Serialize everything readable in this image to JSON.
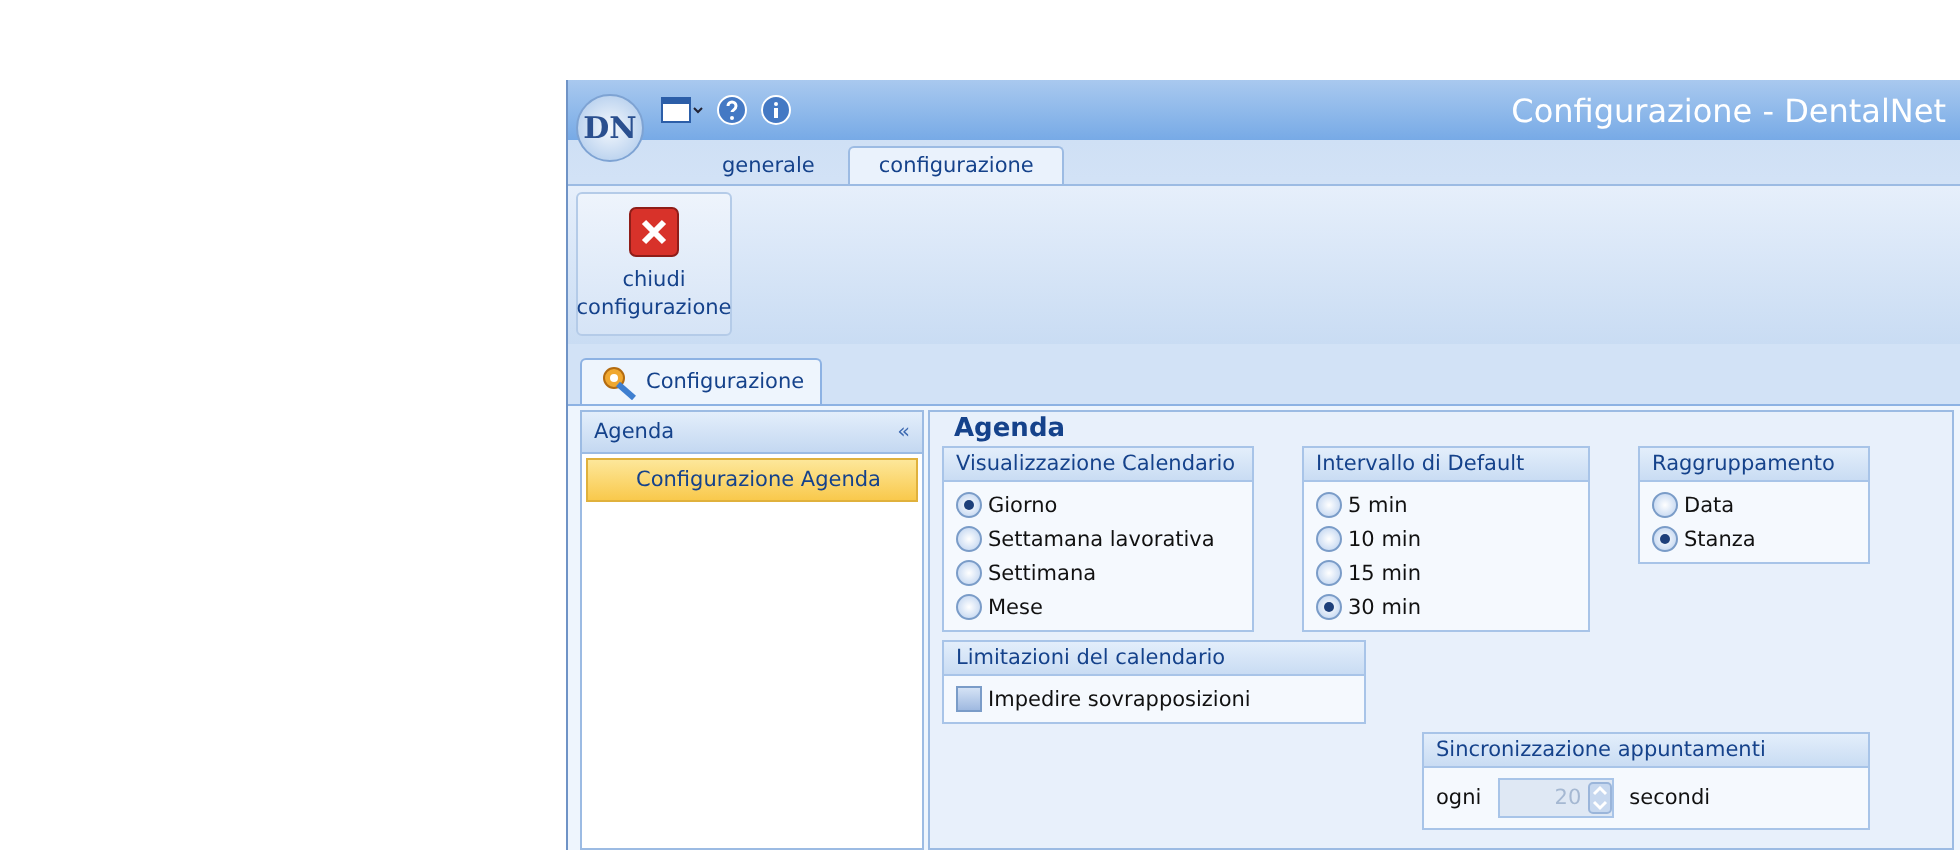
{
  "window": {
    "title": "Configurazione - DentalNet",
    "app_logo": "DN"
  },
  "ribbon_tabs": [
    {
      "label": "generale",
      "selected": false
    },
    {
      "label": "configurazione",
      "selected": true
    }
  ],
  "ribbon_buttons": [
    {
      "label": "chiudi configurazione"
    }
  ],
  "document_tabs": [
    {
      "label": "Configurazione",
      "selected": true
    }
  ],
  "sidebar": {
    "header": "Agenda",
    "collapse": "«",
    "items": [
      {
        "label": "Configurazione Agenda",
        "selected": true
      }
    ]
  },
  "content": {
    "title": "Agenda",
    "groups": [
      {
        "kind": "radio",
        "title": "Visualizzazione Calendario",
        "options": [
          {
            "label": "Giorno",
            "selected": true
          },
          {
            "label": "Settamana lavorativa",
            "selected": false
          },
          {
            "label": "Settimana",
            "selected": false
          },
          {
            "label": "Mese",
            "selected": false
          }
        ]
      },
      {
        "kind": "radio",
        "title": "Intervallo di Default",
        "options": [
          {
            "label": "5 min",
            "selected": false
          },
          {
            "label": "10 min",
            "selected": false
          },
          {
            "label": "15 min",
            "selected": false
          },
          {
            "label": "30 min",
            "selected": true
          }
        ]
      },
      {
        "kind": "radio",
        "title": "Raggruppamento",
        "options": [
          {
            "label": "Data",
            "selected": false
          },
          {
            "label": "Stanza",
            "selected": true
          }
        ]
      },
      {
        "kind": "checkbox",
        "title": "Limitazioni del calendario",
        "options": [
          {
            "label": "Impedire sovrapposizioni",
            "checked": false
          }
        ]
      },
      {
        "kind": "spinner",
        "title": "Sincronizzazione appuntamenti",
        "before": "ogni",
        "value": "20",
        "after": "secondi",
        "disabled": true
      }
    ]
  }
}
